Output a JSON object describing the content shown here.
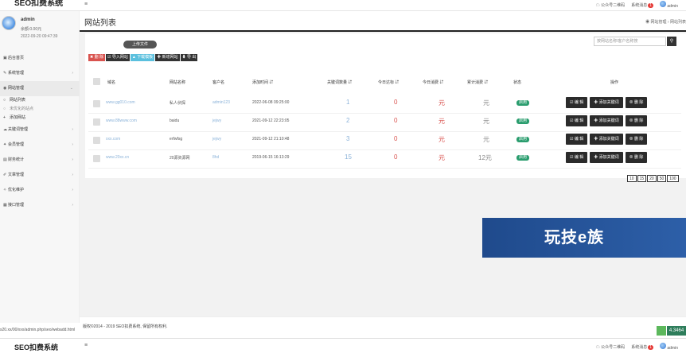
{
  "app": {
    "brand": "SEO扣费系统",
    "menu_icon": "≡"
  },
  "topbar": {
    "qr_label": "公众号二维码",
    "messages_label": "系统消息",
    "messages_count": "1",
    "user": "admin"
  },
  "profile": {
    "name": "admin",
    "balance": "余额:0.00元",
    "time": "2022-09-20 09:47:39"
  },
  "nav": {
    "items": [
      {
        "icon": "▣",
        "label": "后台首页",
        "arrow": ""
      },
      {
        "icon": "✎",
        "label": "系统管理",
        "arrow": "›"
      },
      {
        "icon": "◉",
        "label": "网站管理",
        "arrow": "⌄"
      },
      {
        "icon": "☁",
        "label": "关键词管理",
        "arrow": "›"
      },
      {
        "icon": "✦",
        "label": "会员管理",
        "arrow": "›"
      },
      {
        "icon": "▤",
        "label": "财务统计",
        "arrow": "›"
      },
      {
        "icon": "✐",
        "label": "文章管理",
        "arrow": "›"
      },
      {
        "icon": "✧",
        "label": "优化维护",
        "arrow": "›"
      },
      {
        "icon": "▦",
        "label": "接口管理",
        "arrow": "›"
      }
    ],
    "sub_items": [
      {
        "icon": "○",
        "label": "网站列表"
      },
      {
        "icon": "○",
        "label": "未优化的站点"
      },
      {
        "icon": "+",
        "label": "添加网站"
      }
    ]
  },
  "page": {
    "title": "网站列表",
    "breadcrumb": "◉ 网站管理 › 网站列表"
  },
  "card": {
    "upload_label": "上传文件",
    "search_placeholder": "按网站名称/客户名称搜",
    "search_icon": "⚲",
    "toolbar": [
      {
        "label": "✖ 删 除",
        "style": "red"
      },
      {
        "label": "☑ 导入网站",
        "style": "dark"
      },
      {
        "label": "▲ 下载模板",
        "style": "blue"
      },
      {
        "label": "✚ 新增网站",
        "style": "dark"
      },
      {
        "label": "⬇ 导 出",
        "style": "dark"
      }
    ]
  },
  "table": {
    "headers": [
      "域名",
      "网站名称",
      "客户名",
      "添加时间 ⇵",
      "关键词数量 ⇵",
      "今日达标 ⇵",
      "今日消费 ⇵",
      "累计消费 ⇵",
      "状态",
      "操作"
    ],
    "rows": [
      {
        "domain": "www.gg010.com",
        "site": "私人侦探",
        "client": "admin123",
        "time": "2022-06-08 09:25:00",
        "kw": "1",
        "today": "0",
        "cost": "元",
        "total": "元",
        "status": "启用"
      },
      {
        "domain": "www.88www.com",
        "site": "baidu",
        "client": "jejwy",
        "time": "2021-09-12 22:23:05",
        "kw": "2",
        "today": "0",
        "cost": "元",
        "total": "元",
        "status": "启用"
      },
      {
        "domain": "xxx.com",
        "site": "erfwfsg",
        "client": "jejwy",
        "time": "2021-09-12 21:10:48",
        "kw": "3",
        "today": "0",
        "cost": "元",
        "total": "元",
        "status": "启用"
      },
      {
        "domain": "www.20xx.cn",
        "site": "20源资源网",
        "client": "8hd",
        "time": "2019-06-15 16:13:29",
        "kw": "15",
        "today": "0",
        "cost": "元",
        "total": "12元",
        "status": "启用"
      }
    ],
    "ops": [
      "☑ 编 辑",
      "✚ 添加关键词",
      "⊗ 删 除"
    ]
  },
  "pager": [
    "10",
    "15",
    "20",
    "50",
    "100"
  ],
  "banner": {
    "text": "玩技e族"
  },
  "footer": {
    "copyright": "版权©2014 - 2019 SEO扣费系统, 保留所有权利.",
    "status_url": "s20.xx/00/xxx/admin.php/seo/webadd.html",
    "corner_value": "4.3464"
  },
  "colors": {
    "accent": "#2b2b2b",
    "status_green": "#2a9d6e",
    "danger": "#d9534f",
    "info": "#5bc0de",
    "link": "#8cb3d9"
  }
}
